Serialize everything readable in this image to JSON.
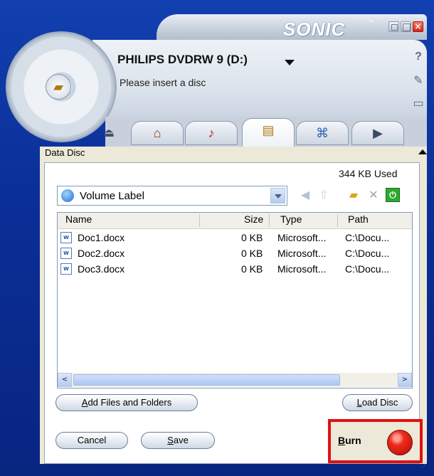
{
  "app": {
    "brand": "SONIC",
    "brand_tm": "™"
  },
  "window_controls": {
    "close": "×"
  },
  "header": {
    "drive": "PHILIPS DVDRW 9 (D:)",
    "status": "Please insert a disc"
  },
  "icons": {
    "disc_center": "folder-icon",
    "help": "help-icon",
    "tools": "wrench-icon",
    "open": "folder-icon",
    "eject": "eject-icon"
  },
  "glyphs": {
    "help": "?",
    "tools": "🔧",
    "open": "▭",
    "eject": "⏏",
    "home": "⌂",
    "music": "♪",
    "data": "▤",
    "copy": "⌘",
    "video": "▶"
  },
  "tabs": [
    {
      "name": "home",
      "icon": "home-icon"
    },
    {
      "name": "music",
      "icon": "music-icon"
    },
    {
      "name": "data",
      "icon": "data-disc-icon",
      "active": true
    },
    {
      "name": "copy",
      "icon": "copy-icon"
    },
    {
      "name": "video",
      "icon": "video-icon"
    }
  ],
  "panel": {
    "title": "Data Disc",
    "used": "344 KB Used",
    "volume_label": "Volume Label",
    "columns": {
      "name": "Name",
      "size": "Size",
      "type": "Type",
      "path": "Path"
    },
    "files": [
      {
        "name": "Doc1.docx",
        "size": "0 KB",
        "type": "Microsoft...",
        "path": "C:\\Docu..."
      },
      {
        "name": "Doc2.docx",
        "size": "0 KB",
        "type": "Microsoft...",
        "path": "C:\\Docu..."
      },
      {
        "name": "Doc3.docx",
        "size": "0 KB",
        "type": "Microsoft...",
        "path": "C:\\Docu..."
      }
    ],
    "file_icon_text": "W"
  },
  "buttons": {
    "add_files_prefix": "A",
    "add_files_rest": "dd Files and Folders",
    "load_disc_prefix": "L",
    "load_disc_rest": "oad Disc",
    "cancel": "Cancel",
    "save_prefix": "S",
    "save_rest": "ave",
    "burn_prefix": "B",
    "burn_rest": "urn"
  },
  "scroll": {
    "left": "<",
    "right": ">"
  },
  "colors": {
    "accent": "#0b2f98",
    "burn_highlight": "#e21010",
    "burn_button": "#ee2a1c"
  }
}
